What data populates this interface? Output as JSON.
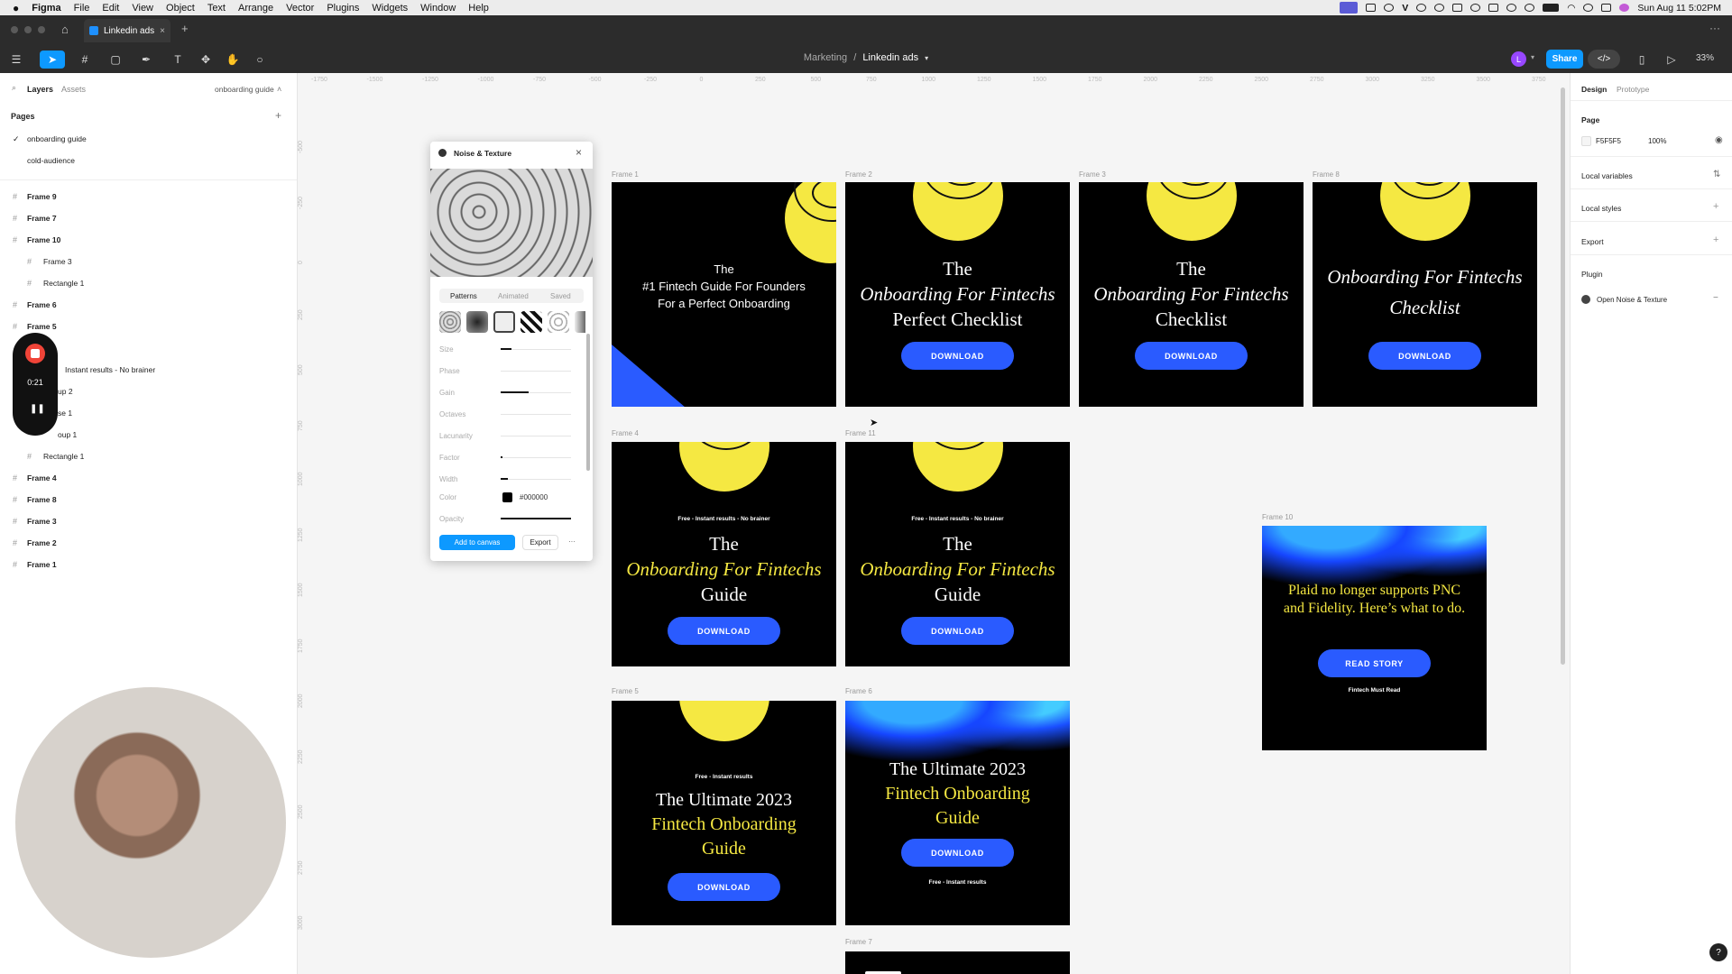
{
  "menubar": {
    "apple": "",
    "items": [
      "Figma",
      "File",
      "Edit",
      "View",
      "Object",
      "Text",
      "Arrange",
      "Vector",
      "Plugins",
      "Widgets",
      "Window",
      "Help"
    ],
    "clock": "Sun Aug 11  5:02PM"
  },
  "tab": {
    "title": "Linkedin ads",
    "close": "×",
    "new": "+"
  },
  "toolbar": {
    "crumb_parent": "Marketing",
    "crumb_sep": "/",
    "crumb_file": "Linkedin ads",
    "avatar": "L",
    "share": "Share",
    "zoom": "33%"
  },
  "left": {
    "tab_layers": "Layers",
    "tab_assets": "Assets",
    "page_selector": "onboarding guide",
    "pages_label": "Pages",
    "pages": [
      "onboarding guide",
      "cold-audience"
    ],
    "layers": [
      {
        "label": "Frame 9",
        "bold": true
      },
      {
        "label": "Frame 7",
        "bold": true
      },
      {
        "label": "Frame 10",
        "bold": true
      },
      {
        "label": "Frame 3",
        "bold": false
      },
      {
        "label": "Rectangle 1",
        "bold": false
      },
      {
        "label": "Frame 6",
        "bold": true
      },
      {
        "label": "Frame 5",
        "bold": true
      },
      {
        "label": "Instant results - No brainer",
        "bold": false
      },
      {
        "label": "up 2",
        "bold": false
      },
      {
        "label": "se 1",
        "bold": false
      },
      {
        "label": "oup 1",
        "bold": false
      },
      {
        "label": "Rectangle 1",
        "bold": false
      },
      {
        "label": "Frame 4",
        "bold": true
      },
      {
        "label": "Frame 8",
        "bold": true
      },
      {
        "label": "Frame 3",
        "bold": true
      },
      {
        "label": "Frame 2",
        "bold": true
      },
      {
        "label": "Frame 1",
        "bold": true
      }
    ]
  },
  "recorder": {
    "time": "0:21"
  },
  "rulers": {
    "h": [
      "-1750",
      "-1500",
      "-1250",
      "-1000",
      "-750",
      "-500",
      "-250",
      "0",
      "250",
      "500",
      "750",
      "1000",
      "1250",
      "1500",
      "1750",
      "2000",
      "2250",
      "2500",
      "2750",
      "3000",
      "3250",
      "3500",
      "3750"
    ],
    "v": [
      "-500",
      "-250",
      "0",
      "250",
      "500",
      "750",
      "1000",
      "1250",
      "1500",
      "1750",
      "2000",
      "2250",
      "2500",
      "2750",
      "3000"
    ]
  },
  "frames": {
    "f1": {
      "label": "Frame 1",
      "title": [
        "The",
        "#1 Fintech Guide For Founders",
        "For a Perfect Onboarding"
      ]
    },
    "f2": {
      "label": "Frame 2",
      "l1": "The",
      "l2": "Onboarding For Fintechs",
      "l3": "Perfect Checklist",
      "btn": "DOWNLOAD"
    },
    "f3": {
      "label": "Frame 3",
      "l1": "The",
      "l2": "Onboarding For Fintechs",
      "l3": "Checklist",
      "btn": "DOWNLOAD"
    },
    "f8": {
      "label": "Frame 8",
      "l1": "Onboarding For Fintechs",
      "l2": "Checklist",
      "btn": "DOWNLOAD"
    },
    "f4": {
      "label": "Frame 4",
      "tag": "Free - Instant results - No brainer",
      "l1": "The",
      "l2": "Onboarding For Fintechs",
      "l3": "Guide",
      "btn": "DOWNLOAD"
    },
    "f11": {
      "label": "Frame 11",
      "tag": "Free - Instant results - No brainer",
      "l1": "The",
      "l2": "Onboarding For Fintechs",
      "l3": "Guide",
      "btn": "DOWNLOAD"
    },
    "f10": {
      "label": "Frame 10",
      "l1": "Plaid no longer supports PNC and Fidelity. Here’s what to do.",
      "btn": "READ STORY",
      "foot": "Fintech Must Read"
    },
    "f5": {
      "label": "Frame 5",
      "tag": "Free - Instant results",
      "l1": "The Ultimate 2023",
      "l2": "Fintech Onboarding",
      "l3": "Guide",
      "btn": "DOWNLOAD"
    },
    "f6": {
      "label": "Frame 6",
      "l1": "The Ultimate 2023",
      "l2": "Fintech Onboarding",
      "l3": "Guide",
      "btn": "DOWNLOAD",
      "foot": "Free - Instant results"
    },
    "f7": {
      "label": "Frame 7"
    }
  },
  "plugin": {
    "title": "Noise & Texture",
    "tabs": [
      "Patterns",
      "Animated",
      "Saved"
    ],
    "rows": [
      {
        "label": "Size",
        "value": 0.15
      },
      {
        "label": "Phase",
        "value": 0
      },
      {
        "label": "Gain",
        "value": 0.4
      },
      {
        "label": "Octaves",
        "value": 0
      },
      {
        "label": "Lacunarity",
        "value": 0
      },
      {
        "label": "Factor",
        "value": 0.03
      },
      {
        "label": "Width",
        "value": 0.1
      }
    ],
    "color_label": "Color",
    "color_value": "#000000",
    "opacity_label": "Opacity",
    "opacity_value": 1,
    "add_btn": "Add to canvas",
    "export_btn": "Export",
    "more": "···"
  },
  "right": {
    "tab_design": "Design",
    "tab_prototype": "Prototype",
    "page_label": "Page",
    "bg_hex": "F5F5F5",
    "bg_opacity": "100%",
    "local_variables": "Local variables",
    "local_styles": "Local styles",
    "export": "Export",
    "plugin_label": "Plugin",
    "plugin_item": "Open Noise & Texture"
  },
  "colors": {
    "accent": "#0d99ff",
    "cta": "#2a5bff",
    "moon": "#f5e842",
    "yellow_text": "#f5e842"
  }
}
